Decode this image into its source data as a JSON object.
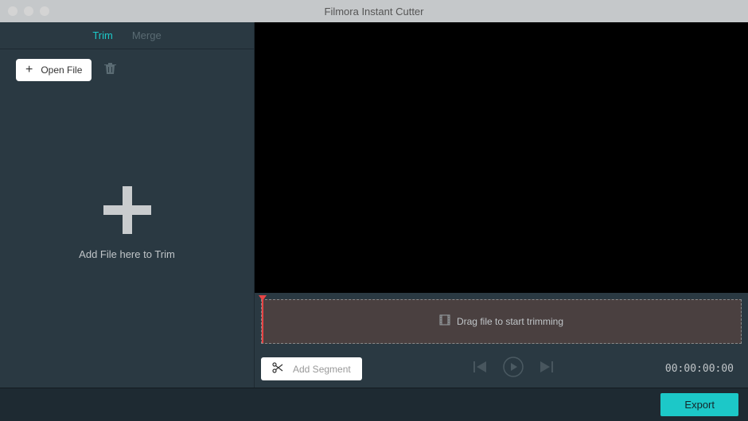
{
  "window": {
    "title": "Filmora Instant Cutter"
  },
  "tabs": {
    "trim": "Trim",
    "merge": "Merge",
    "active": "trim"
  },
  "sidebar": {
    "open_file_label": "Open File",
    "drop_text": "Add File here to Trim"
  },
  "timeline": {
    "placeholder_text": "Drag file to start trimming",
    "add_segment_label": "Add Segment",
    "timecode": "00:00:00:00"
  },
  "footer": {
    "export_label": "Export"
  }
}
